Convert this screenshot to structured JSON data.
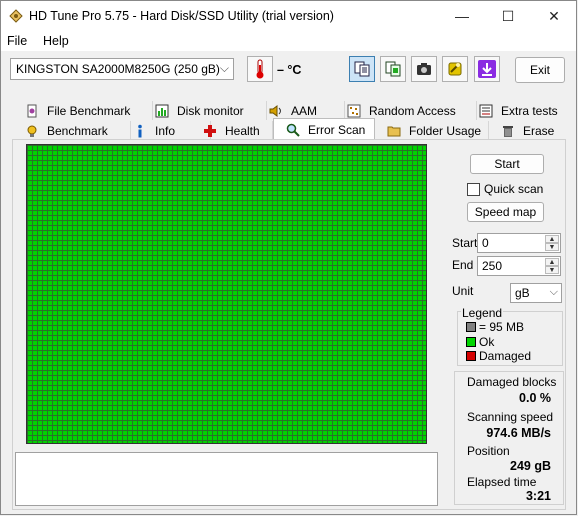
{
  "window": {
    "title": "HD Tune Pro 5.75 - Hard Disk/SSD Utility (trial version)",
    "minimize": "—",
    "maximize": "☐",
    "close": "✕"
  },
  "menu": {
    "file": "File",
    "help": "Help"
  },
  "toolbar": {
    "drive": "KINGSTON SA2000M8250G (250 gB)",
    "temperature": "– °C",
    "exit": "Exit"
  },
  "tabs_top": [
    "File Benchmark",
    "Disk monitor",
    "AAM",
    "Random Access",
    "Extra tests"
  ],
  "tabs_bottom": [
    "Benchmark",
    "Info",
    "Health",
    "Error Scan",
    "Folder Usage",
    "Erase"
  ],
  "selected_tab": "Error Scan",
  "scan": {
    "start_button": "Start",
    "quick_scan": "Quick scan",
    "quick_scan_checked": false,
    "speed_map": "Speed map",
    "start_label": "Start",
    "start_value": "0",
    "end_label": "End",
    "end_value": "250",
    "unit_label": "Unit",
    "unit_value": "gB"
  },
  "legend": {
    "title": "Legend",
    "block": "= 95 MB",
    "ok": "Ok",
    "damaged": "Damaged",
    "colors": {
      "block": "#808080",
      "ok": "#00d400",
      "damaged": "#d40000"
    }
  },
  "stats": {
    "damaged_label": "Damaged blocks",
    "damaged_value": "0.0 %",
    "speed_label": "Scanning speed",
    "speed_value": "974.6 MB/s",
    "position_label": "Position",
    "position_value": "249 gB",
    "elapsed_label": "Elapsed time",
    "elapsed_value": "3:21"
  }
}
